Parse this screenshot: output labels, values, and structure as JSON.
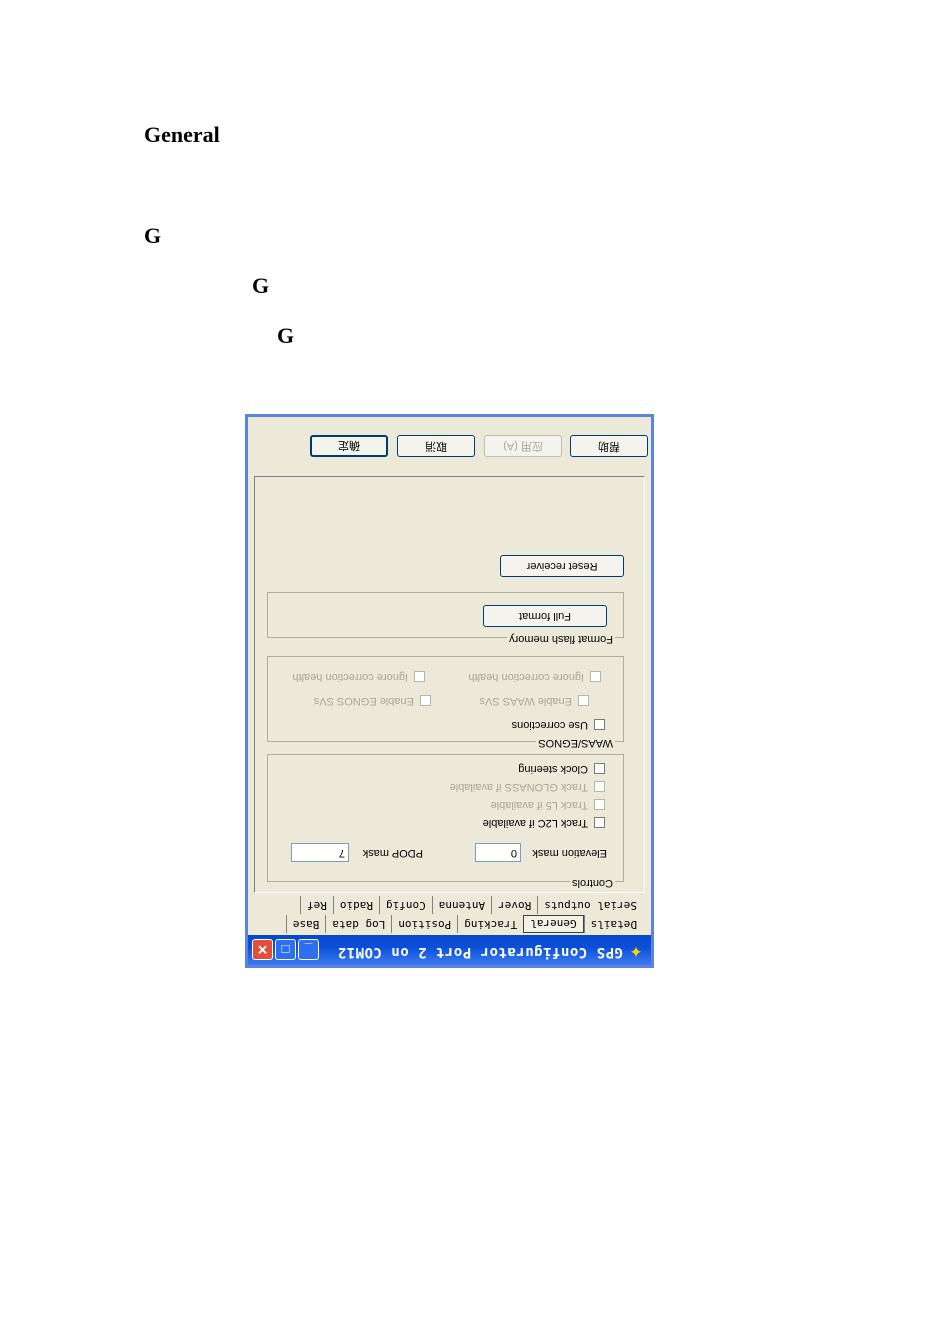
{
  "doc": {
    "heading": "General",
    "line1": "G",
    "line2": "G",
    "line3": "G"
  },
  "window": {
    "title": "GPS Configurator Port 2 on COM12",
    "tabs_row1": [
      "Details",
      "General",
      "Tracking",
      "Position",
      "Log data",
      "Base"
    ],
    "tabs_row2": [
      "Serial outputs",
      "Rover",
      "Antenna",
      "Config",
      "Radio",
      "Ref"
    ],
    "active_tab": "General",
    "controls": {
      "label": "Controls",
      "elevation_mask_label": "Elevation mask",
      "elevation_mask_value": "0",
      "pdop_mask_label": "PDOP mask",
      "pdop_mask_value": "7",
      "track_l2c": "Track L2C if available",
      "track_l5": "Track L5 if available",
      "track_glonass": "Track GLONASS if available",
      "clock_steering": "Clock steering"
    },
    "waas": {
      "label": "WAAS/EGNOS",
      "use_corrections": "Use corrections",
      "enable_waas": "Enable WAAS SVs",
      "enable_egnos": "Enable EGNOS SVs",
      "ignore_health_1": "Ignore correction health",
      "ignore_health_2": "Ignore correction health"
    },
    "flash": {
      "label": "Format flash memory",
      "full_format": "Full format"
    },
    "reset_receiver": "Reset receiver",
    "buttons": {
      "ok": "确定",
      "cancel": "取消",
      "apply": "应用 (A)",
      "help": "帮助"
    }
  }
}
